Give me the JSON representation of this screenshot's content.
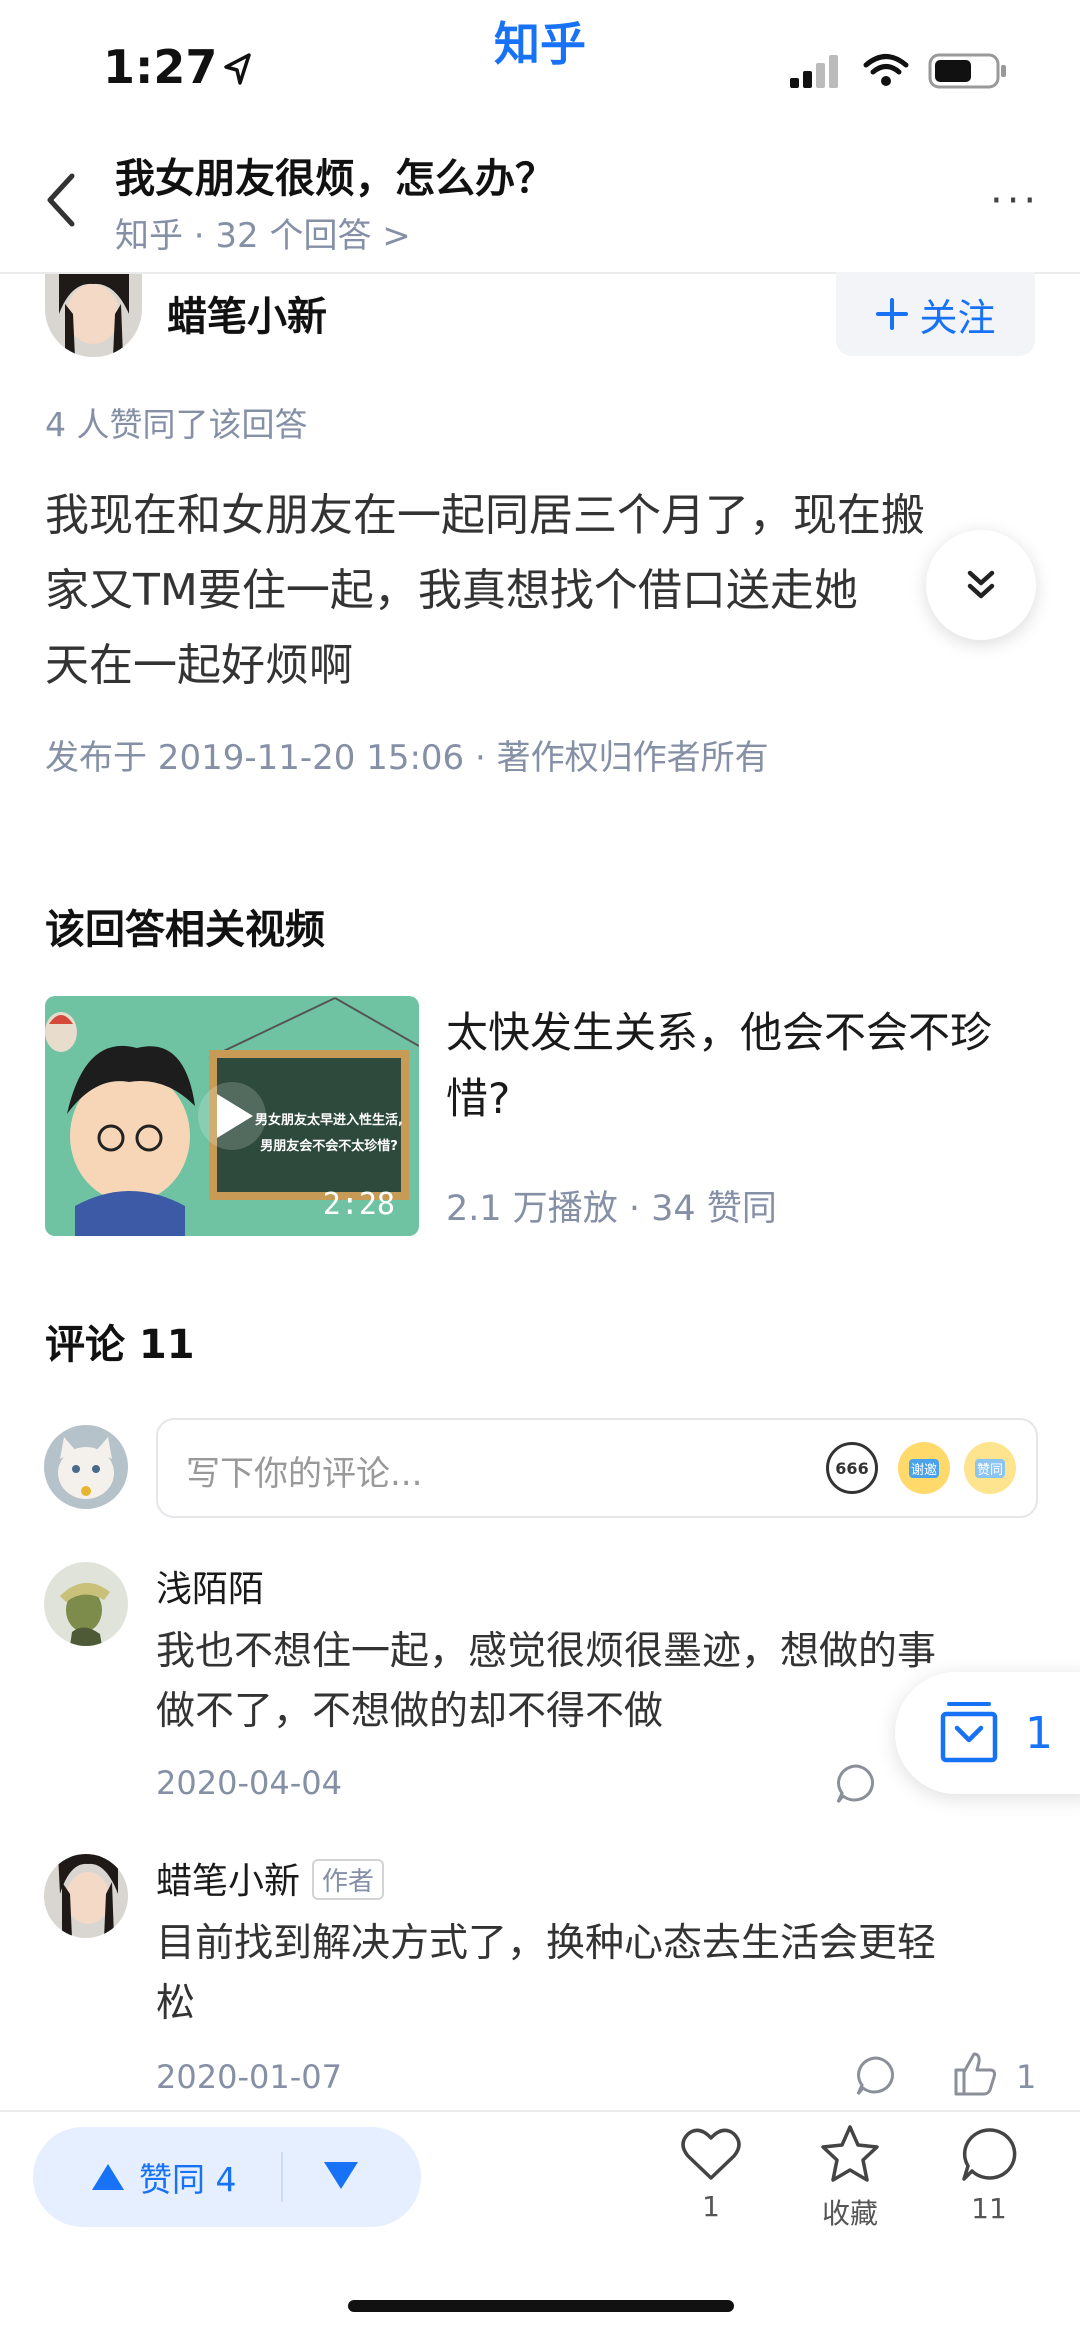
{
  "status_bar": {
    "time": "1:27",
    "app_name": "知乎"
  },
  "nav": {
    "title": "我女朋友很烦，怎么办？",
    "subtitle": "知乎 · 32 个回答 >",
    "more": "···"
  },
  "author": {
    "name": "蜡笔小新",
    "follow_label": "关注"
  },
  "answer": {
    "upvote_line": "4 人赞同了该回答",
    "lines": [
      "我现在和女朋友在一起同居三个月了，现在搬",
      "家又TM要住一起，我真想找个借口送走她",
      "天在一起好烦啊"
    ],
    "publish_info": "发布于 2019-11-20 15:06 · 著作权归作者所有"
  },
  "related_video": {
    "section_title": "该回答相关视频",
    "title": "太快发生关系，他会不会不珍惜?",
    "meta": "2.1 万播放 · 34 赞同",
    "duration": "2:28",
    "thumb_line1": "男女朋友太早进入性生活,",
    "thumb_line2": "男朋友会不会不太珍惜?"
  },
  "comments": {
    "title": "评论 11",
    "placeholder": "写下你的评论...",
    "emojis": [
      "666",
      "谢邀",
      "赞同"
    ],
    "items": [
      {
        "name": "浅陌陌",
        "text": [
          "我也不想住一起，感觉很烦很墨迹，想做的事",
          "做不了，不想做的却不得不做"
        ],
        "date": "2020-04-04"
      },
      {
        "name": "蜡笔小新",
        "badge": "作者",
        "text": [
          "目前找到解决方式了，换种心态去生活会更轻",
          "松"
        ],
        "date": "2020-01-07",
        "likes": "1"
      }
    ]
  },
  "collect_fab": {
    "count": "1"
  },
  "bottom_bar": {
    "upvote_label": "赞同 4",
    "like_count": "1",
    "favorite_label": "收藏",
    "comment_count": "11"
  },
  "colors": {
    "accent": "#1772f6",
    "meta": "#8590a6",
    "pill_bg": "#e5efff"
  }
}
